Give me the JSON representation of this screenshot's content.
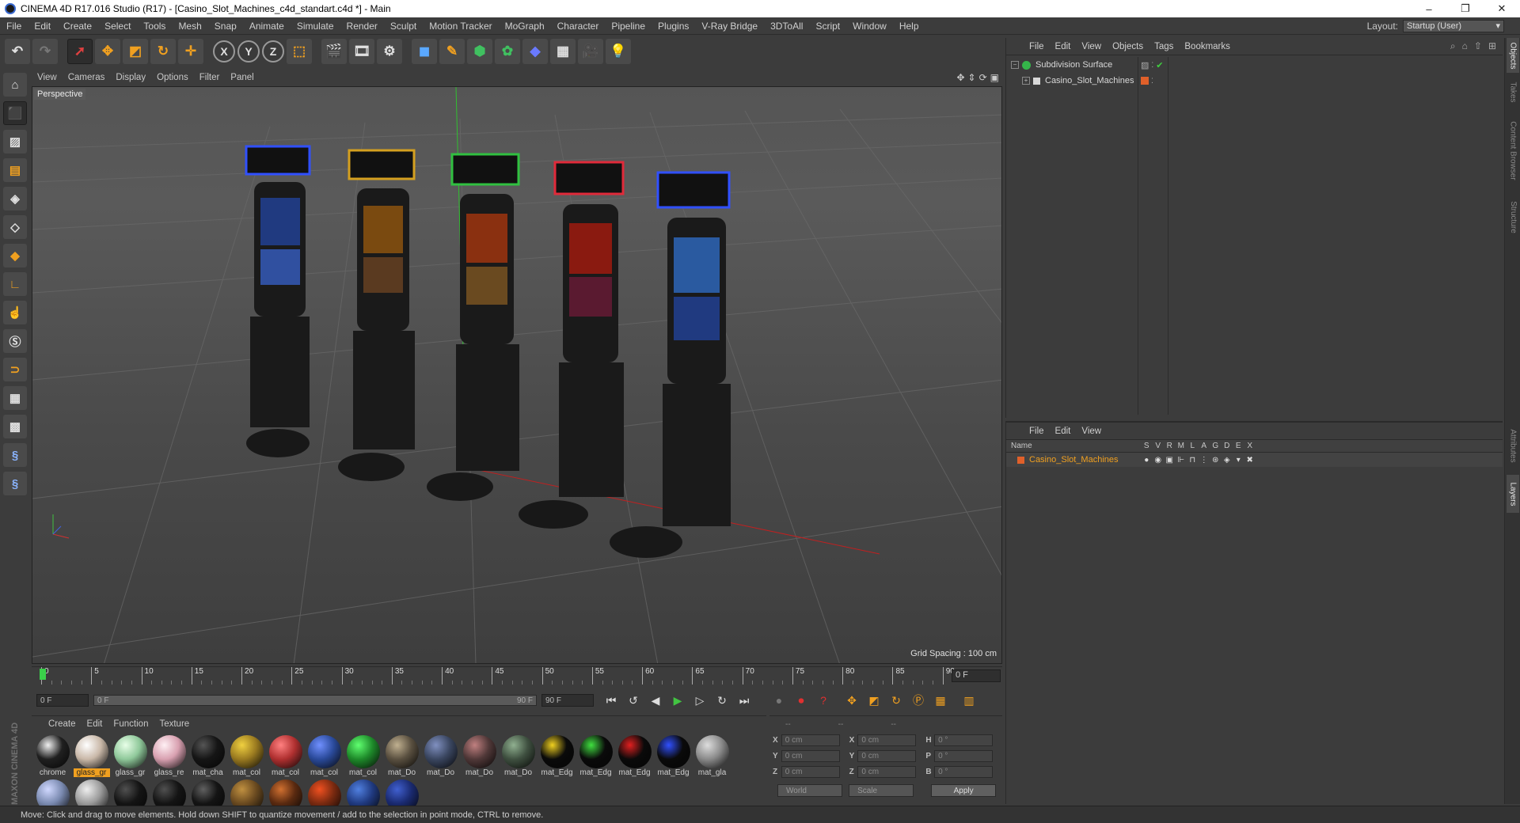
{
  "window": {
    "title": "CINEMA 4D R17.016 Studio (R17) - [Casino_Slot_Machines_c4d_standart.c4d *] - Main",
    "controls": [
      "–",
      "❐",
      "✕"
    ]
  },
  "menubar": {
    "items": [
      "File",
      "Edit",
      "Create",
      "Select",
      "Tools",
      "Mesh",
      "Snap",
      "Animate",
      "Simulate",
      "Render",
      "Sculpt",
      "Motion Tracker",
      "MoGraph",
      "Character",
      "Pipeline",
      "Plugins",
      "V-Ray Bridge",
      "3DToAll",
      "Script",
      "Window",
      "Help"
    ],
    "layout_label": "Layout:",
    "layout_value": "Startup (User)"
  },
  "viewport": {
    "menu": [
      "View",
      "Cameras",
      "Display",
      "Options",
      "Filter",
      "Panel"
    ],
    "camera_label": "Perspective",
    "grid_spacing": "Grid Spacing : 100 cm"
  },
  "timeline": {
    "ticks": [
      "0",
      "5",
      "10",
      "15",
      "20",
      "25",
      "30",
      "35",
      "40",
      "45",
      "50",
      "55",
      "60",
      "65",
      "70",
      "75",
      "80",
      "85",
      "90"
    ],
    "current_frame": "0 F",
    "start_field": "0 F",
    "slider_left": "0 F",
    "slider_right": "90 F",
    "end_field": "90 F"
  },
  "materials": {
    "menu": [
      "Create",
      "Edit",
      "Function",
      "Texture"
    ],
    "items": [
      {
        "label": "chrome",
        "color": "#202020",
        "shine": "#f0f0f0"
      },
      {
        "label": "glass_gr",
        "color": "#c9b8a8",
        "shine": "#ffffff",
        "active": true
      },
      {
        "label": "glass_gr",
        "color": "#8fc89a",
        "shine": "#e8ffe8"
      },
      {
        "label": "glass_re",
        "color": "#d8a0b0",
        "shine": "#fff0f4"
      },
      {
        "label": "mat_cha",
        "color": "#151515",
        "shine": "#555555"
      },
      {
        "label": "mat_col",
        "color": "#9a7a20",
        "shine": "#f0d040"
      },
      {
        "label": "mat_col",
        "color": "#b03030",
        "shine": "#ff8080"
      },
      {
        "label": "mat_col",
        "color": "#2a4a9a",
        "shine": "#7090ff"
      },
      {
        "label": "mat_col",
        "color": "#1e8a2a",
        "shine": "#60ff70"
      },
      {
        "label": "mat_Do",
        "color": "#5a5040",
        "shine": "#c0b090"
      },
      {
        "label": "mat_Do",
        "color": "#3a4660",
        "shine": "#8090c0"
      },
      {
        "label": "mat_Do",
        "color": "#503838",
        "shine": "#c08080"
      },
      {
        "label": "mat_Do",
        "color": "#3f5040",
        "shine": "#90b090"
      },
      {
        "label": "mat_Edg",
        "color": "#0a0a0a",
        "shine": "#f0d020"
      },
      {
        "label": "mat_Edg",
        "color": "#0a0a0a",
        "shine": "#40e040"
      },
      {
        "label": "mat_Edg",
        "color": "#0a0a0a",
        "shine": "#e02020"
      },
      {
        "label": "mat_Edg",
        "color": "#0a0a0a",
        "shine": "#3050ff"
      },
      {
        "label": "mat_gla",
        "color": "#8a8a8a",
        "shine": "#dddddd"
      },
      {
        "label": "",
        "color": "#7a8ab0",
        "shine": "#d0d8ff"
      },
      {
        "label": "",
        "color": "#9a9a9a",
        "shine": "#eeeeee"
      },
      {
        "label": "",
        "color": "#141414",
        "shine": "#505050"
      },
      {
        "label": "",
        "color": "#141414",
        "shine": "#505050"
      },
      {
        "label": "",
        "color": "#141414",
        "shine": "#606060"
      },
      {
        "label": "",
        "color": "#6a4a20",
        "shine": "#c09040"
      },
      {
        "label": "",
        "color": "#5a2a10",
        "shine": "#d07030"
      },
      {
        "label": "",
        "color": "#7a2a10",
        "shine": "#f05020"
      },
      {
        "label": "",
        "color": "#203a80",
        "shine": "#5080e0"
      },
      {
        "label": "",
        "color": "#1a2a70",
        "shine": "#4060d0"
      }
    ]
  },
  "coords": {
    "head": [
      "--",
      "--",
      "--"
    ],
    "rows": [
      {
        "a1": "X",
        "v1": "0 cm",
        "a2": "X",
        "v2": "0 cm",
        "a3": "H",
        "v3": "0 °"
      },
      {
        "a1": "Y",
        "v1": "0 cm",
        "a2": "Y",
        "v2": "0 cm",
        "a3": "P",
        "v3": "0 °"
      },
      {
        "a1": "Z",
        "v1": "0 cm",
        "a2": "Z",
        "v2": "0 cm",
        "a3": "B",
        "v3": "0 °"
      }
    ],
    "space": "World",
    "mode": "Scale",
    "apply": "Apply"
  },
  "objects": {
    "menu": [
      "File",
      "Edit",
      "View",
      "Objects",
      "Tags",
      "Bookmarks"
    ],
    "rows": [
      {
        "name": "Subdivision Surface",
        "icon_color": "#35b54a"
      },
      {
        "name": "Casino_Slot_Machines",
        "icon_color": "#d8d8d8"
      }
    ]
  },
  "layers": {
    "menu": [
      "File",
      "Edit",
      "View"
    ],
    "columns": [
      "Name",
      "S",
      "V",
      "R",
      "M",
      "L",
      "A",
      "G",
      "D",
      "E",
      "X"
    ],
    "rows": [
      {
        "name": "Casino_Slot_Machines",
        "color": "#e0602a"
      }
    ]
  },
  "right_tabs": [
    "Objects",
    "Takes",
    "Content Browser",
    "Structure",
    "Attributes",
    "Layers"
  ],
  "status": "Move: Click and drag to move elements. Hold down SHIFT to quantize movement / add to the selection in point mode, CTRL to remove.",
  "brand": "MAXON CINEMA 4D"
}
